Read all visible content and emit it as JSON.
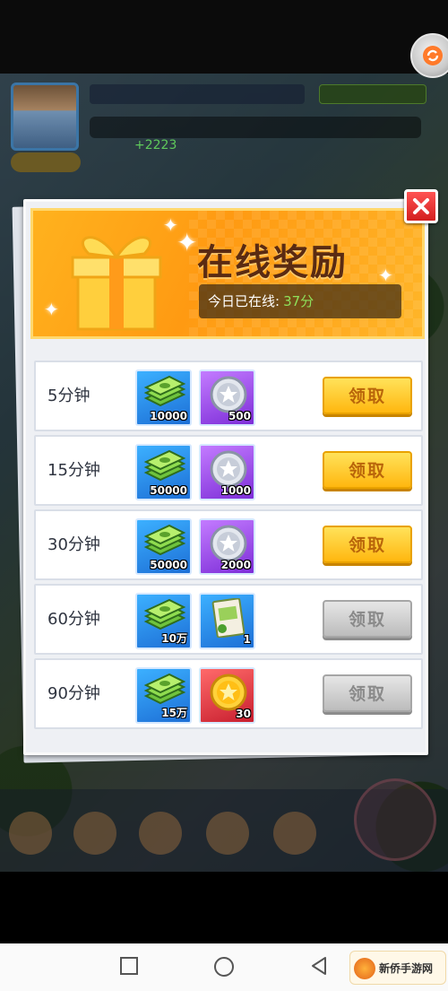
{
  "hud": {
    "plus_text": "+2223"
  },
  "popup": {
    "title": "在线奖励",
    "online_label": "今日已在线:",
    "online_value": "37分",
    "rows": [
      {
        "time": "5分钟",
        "rewards": [
          {
            "icon": "cash-stack-icon",
            "amount": "10000"
          },
          {
            "icon": "silver-coin-icon",
            "amount": "500"
          }
        ],
        "button": "领取",
        "state": "active"
      },
      {
        "time": "15分钟",
        "rewards": [
          {
            "icon": "cash-stack-icon",
            "amount": "50000"
          },
          {
            "icon": "silver-coin-icon",
            "amount": "1000"
          }
        ],
        "button": "领取",
        "state": "active"
      },
      {
        "time": "30分钟",
        "rewards": [
          {
            "icon": "cash-stack-icon",
            "amount": "50000"
          },
          {
            "icon": "silver-coin-icon",
            "amount": "2000"
          }
        ],
        "button": "领取",
        "state": "active"
      },
      {
        "time": "60分钟",
        "rewards": [
          {
            "icon": "cash-stack-icon",
            "amount": "10万"
          },
          {
            "icon": "card-pack-icon",
            "amount": "1"
          }
        ],
        "button": "领取",
        "state": "disabled"
      },
      {
        "time": "90分钟",
        "rewards": [
          {
            "icon": "cash-stack-icon",
            "amount": "15万"
          },
          {
            "icon": "gold-coin-icon",
            "amount": "30"
          }
        ],
        "button": "领取",
        "state": "disabled"
      }
    ]
  },
  "watermark": {
    "text": "新侨手游网"
  },
  "colors": {
    "banner": "#ffa41a",
    "claim_active": "#ffc41f",
    "claim_disabled": "#c9c9c9",
    "close_button": "#e63232",
    "online_value": "#8fe05a"
  }
}
